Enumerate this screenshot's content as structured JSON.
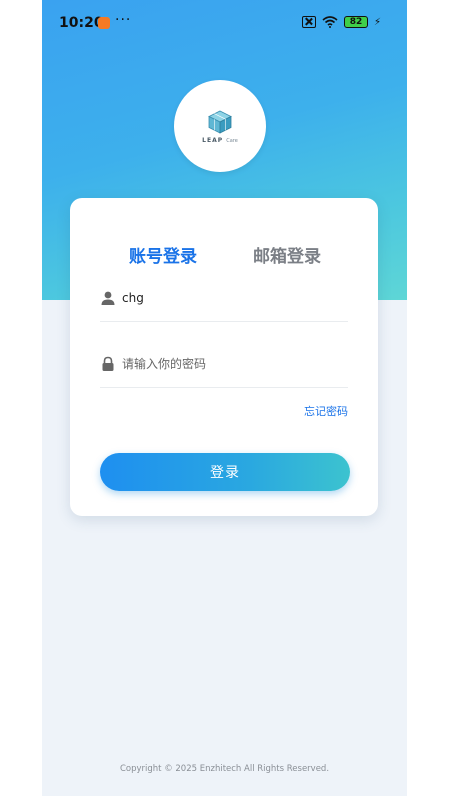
{
  "status_bar": {
    "time": "10:20",
    "more": "···",
    "battery": "82"
  },
  "logo": {
    "brand": "LEAP",
    "sub": "Care"
  },
  "tabs": [
    {
      "label": "账号登录",
      "active": true
    },
    {
      "label": "邮箱登录",
      "active": false
    }
  ],
  "form": {
    "username_value": "chg",
    "password_placeholder": "请输入你的密码",
    "forgot_label": "忘记密码",
    "login_label": "登录"
  },
  "footer": {
    "copyright": "Copyright © 2025 Enzhitech All Rights Reserved."
  },
  "colors": {
    "accent": "#1a73e8",
    "gradient_start": "#3aa2f0",
    "gradient_end": "#5ed6d6"
  }
}
